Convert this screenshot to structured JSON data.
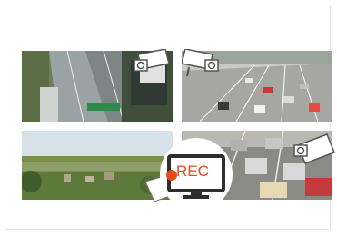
{
  "rec_badge": {
    "label": "REC",
    "dot_color": "#e64b1d",
    "text_color": "#e64b1d"
  },
  "icons": [
    "cctv-camera-icon",
    "cctv-camera-icon",
    "cctv-camera-icon",
    "cctv-camera-icon",
    "monitor-icon"
  ],
  "tiles": [
    {
      "name": "highway-aerial-feed"
    },
    {
      "name": "traffic-jam-feed"
    },
    {
      "name": "countryside-landscape-feed"
    },
    {
      "name": "road-cars-feed"
    }
  ]
}
